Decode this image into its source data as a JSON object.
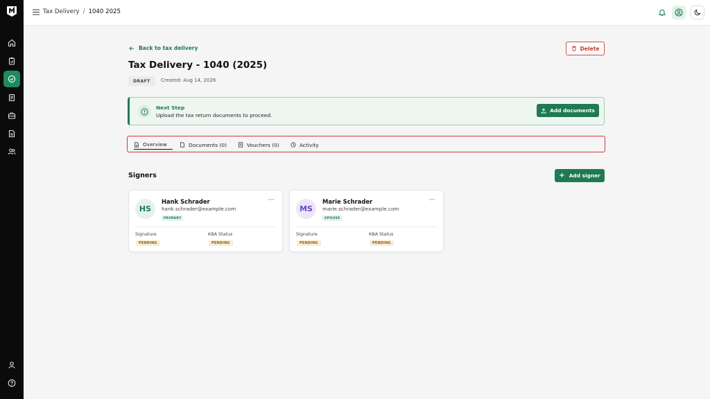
{
  "breadcrumb": {
    "parent": "Tax Delivery",
    "separator": "/",
    "current": "1040 2025"
  },
  "header": {
    "back_label": "Back to tax delivery",
    "delete_label": "Delete",
    "title": "Tax Delivery - 1040 (2025)",
    "status_badge": "DRAFT",
    "created": "Created: Aug 14, 2026"
  },
  "next_step": {
    "title": "Next Step",
    "description": "Upload the tax return documents to proceed.",
    "action_label": "Add documents"
  },
  "tabs": [
    {
      "label": "Overview",
      "active": true
    },
    {
      "label": "Documents (0)",
      "active": false
    },
    {
      "label": "Vouchers (0)",
      "active": false
    },
    {
      "label": "Activity",
      "active": false
    }
  ],
  "signers": {
    "title": "Signers",
    "add_label": "Add signer",
    "items": [
      {
        "initials": "HS",
        "name": "Hank Schrader",
        "email": "hank.schrader@example.com",
        "role": "PRIMARY",
        "signature_label": "Signature",
        "signature_status": "PENDING",
        "kba_label": "KBA Status",
        "kba_status": "PENDING",
        "more": "⋯"
      },
      {
        "initials": "MS",
        "name": "Marie Schrader",
        "email": "marie.schrader@example.com",
        "role": "SPOUSE",
        "signature_label": "Signature",
        "signature_status": "PENDING",
        "kba_label": "KBA Status",
        "kba_status": "PENDING",
        "more": "⋯"
      }
    ]
  },
  "colors": {
    "brand": "#1f7a52",
    "danger": "#c53a3a",
    "pending_bg": "#fbecd2",
    "primary_avatar": "#1f7a52",
    "spouse_avatar": "#6b46c1"
  },
  "icons": {
    "rail": [
      "home-icon",
      "clipboard-icon",
      "check-circle-icon",
      "receipt-icon",
      "briefcase-icon",
      "document-icon",
      "users-icon",
      "user-icon",
      "help-icon"
    ],
    "topbar": [
      "menu-icon",
      "bell-icon",
      "user-circle-icon",
      "moon-icon"
    ]
  }
}
